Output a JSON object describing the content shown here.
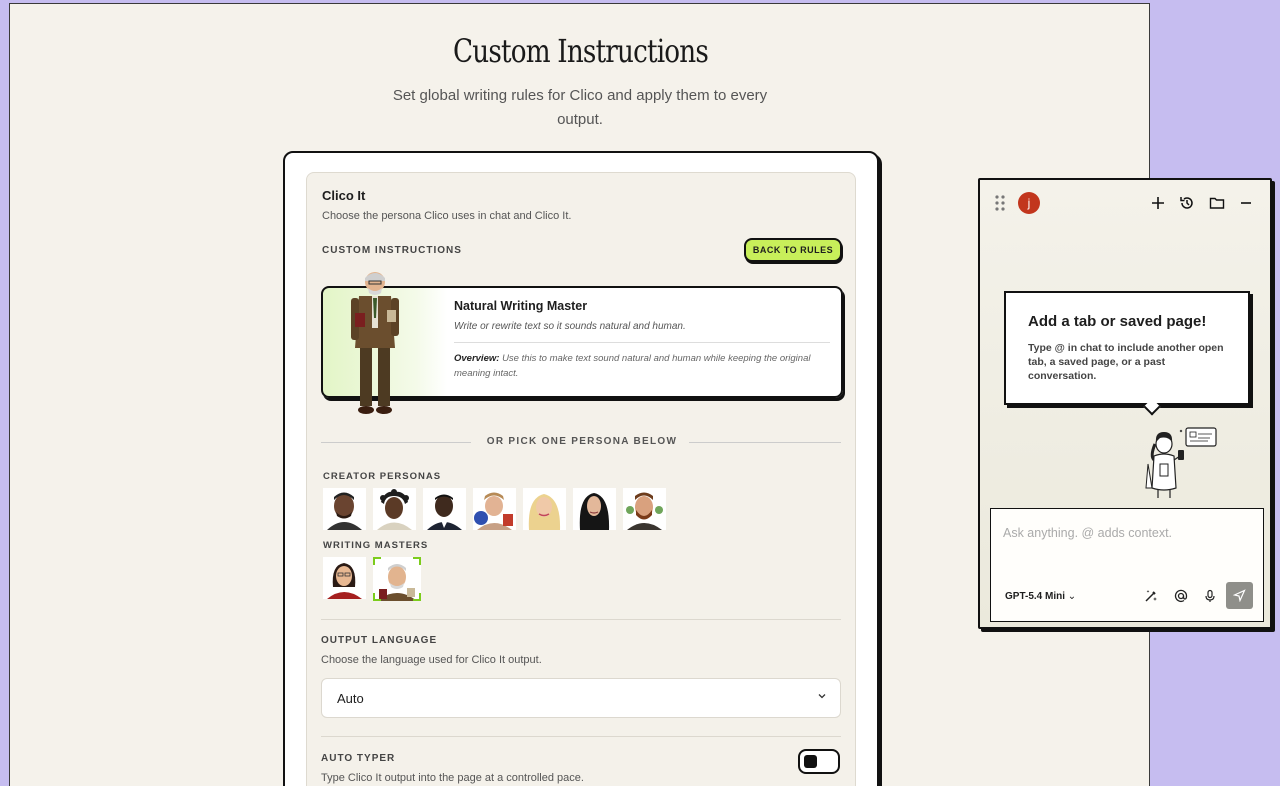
{
  "page": {
    "title": "Custom Instructions",
    "subtitle": "Set global writing rules for Clico and apply them to every output."
  },
  "clico_it": {
    "title": "Clico It",
    "description": "Choose the persona Clico uses in chat and Clico It.",
    "custom_instructions_label": "CUSTOM INSTRUCTIONS",
    "back_button": "BACK TO RULES"
  },
  "selected_persona": {
    "name": "Natural Writing Master",
    "tagline": "Write or rewrite text so it sounds natural and human.",
    "overview_label": "Overview:",
    "overview_text": "Use this to make text sound natural and human while keeping the original meaning intact."
  },
  "picker": {
    "or_text": "OR  PICK ONE PERSONA BELOW",
    "creator_label": "CREATOR PERSONAS",
    "writing_label": "WRITING MASTERS"
  },
  "output_language": {
    "label": "OUTPUT LANGUAGE",
    "description": "Choose the language used for Clico It output.",
    "value": "Auto"
  },
  "auto_typer": {
    "label": "AUTO TYPER",
    "description": "Type Clico It output into the page at a controlled pace.",
    "enabled": false
  },
  "panel": {
    "user_initial": "j",
    "tip_title": "Add a tab or saved page!",
    "tip_body": "Type @ in chat to include another open tab, a saved page, or a past conversation.",
    "chat_placeholder": "Ask anything. @ adds context.",
    "model": "GPT-5.4 Mini",
    "model_chevron": "⌄"
  },
  "colors": {
    "page_bg": "#f5f2eb",
    "outer_bg": "#c6bdf0",
    "accent_green": "#c8ef5a",
    "avatar_red": "#c2361d"
  }
}
